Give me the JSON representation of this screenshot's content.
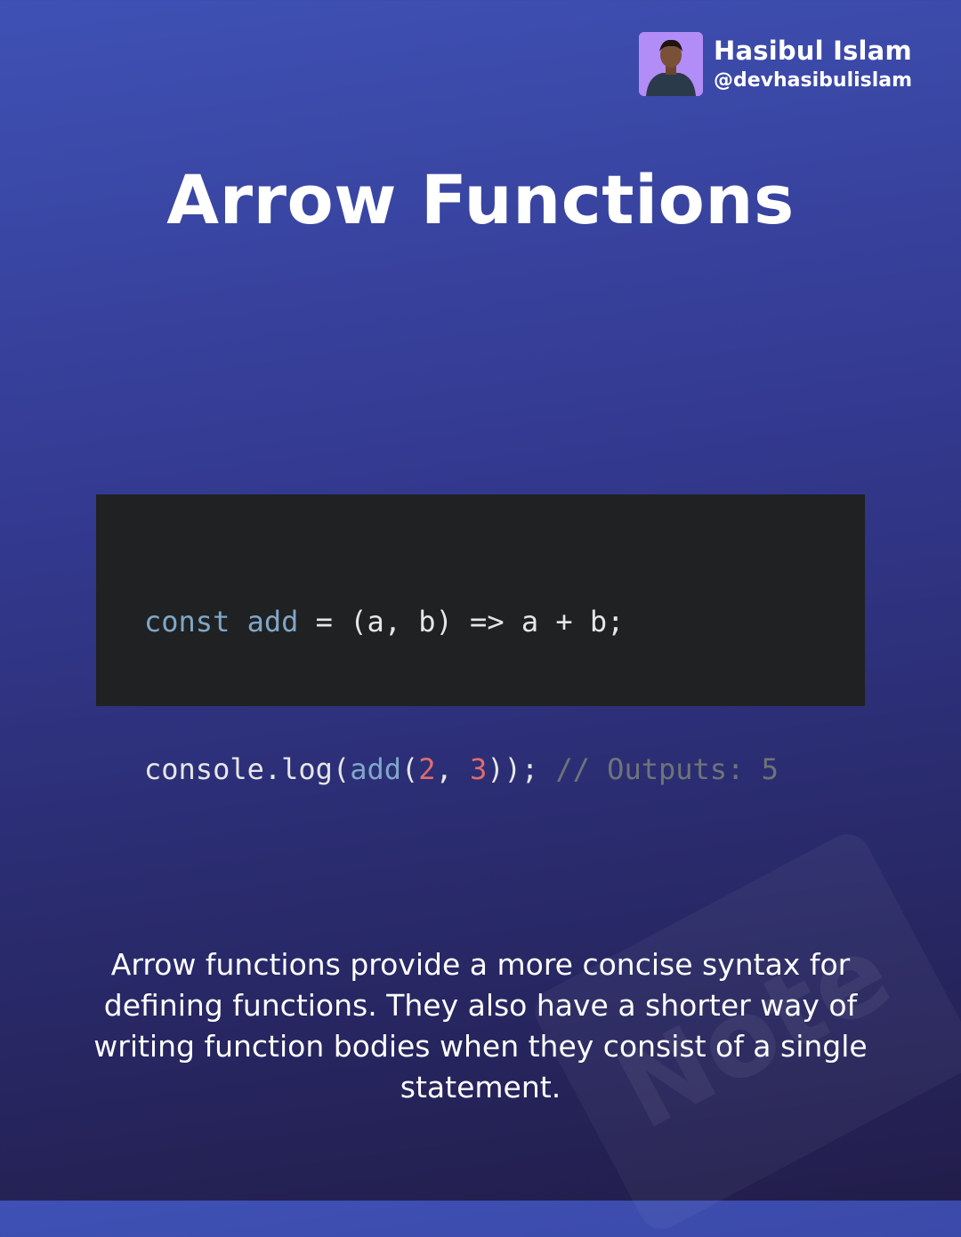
{
  "author": {
    "name": "Hasibul Islam",
    "handle": "@devhasibulislam"
  },
  "title": "Arrow Functions",
  "code": {
    "line1": {
      "keyword": "const",
      "space1": " ",
      "identifier": "add",
      "rest": " = (a, b) => a + b;"
    },
    "line2": {
      "prefix": "console.log(",
      "fn": "add",
      "paren": "(",
      "num1": "2",
      "sep": ", ",
      "num2": "3",
      "suffix": ")); ",
      "comment": "// Outputs: 5"
    }
  },
  "watermark": "Note",
  "description": "Arrow functions provide a more concise syntax for defining functions. They also have a shorter way of writing function bodies when they consist of a single statement.",
  "colors": {
    "code_background": "#202122",
    "keyword": "#7fa7c9",
    "number": "#e06c6c",
    "comment": "#6f7479",
    "avatar_background": "#b28cf7"
  }
}
